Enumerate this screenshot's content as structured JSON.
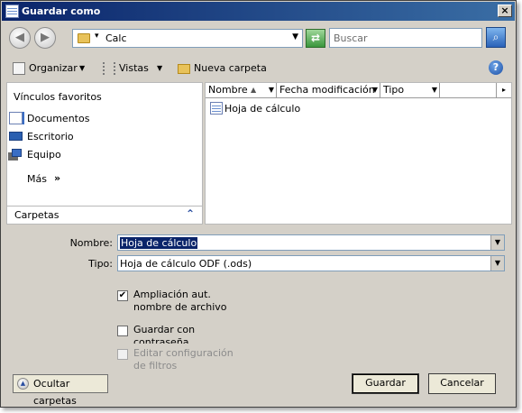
{
  "window": {
    "title": "Guardar como"
  },
  "nav": {
    "address": "Calc",
    "search_placeholder": "Buscar"
  },
  "toolbar": {
    "organize": "Organizar",
    "views": "Vistas",
    "new_folder": "Nueva carpeta"
  },
  "sidebar": {
    "favorites_header": "Vínculos favoritos",
    "items": [
      {
        "label": "Documentos"
      },
      {
        "label": "Escritorio"
      },
      {
        "label": "Equipo"
      }
    ],
    "more": "Más",
    "more_arrow": "»",
    "folders": "Carpetas"
  },
  "file_list": {
    "columns": [
      "Nombre",
      "Fecha modificación",
      "Tipo"
    ],
    "items": [
      {
        "name": "Hoja de cálculo"
      }
    ]
  },
  "form": {
    "name_label": "Nombre:",
    "name_value": "Hoja de cálculo",
    "type_label": "Tipo:",
    "type_value": "Hoja de cálculo ODF (.ods)"
  },
  "options": {
    "auto_ext": "Ampliación aut. nombre de archivo",
    "password": "Guardar con contraseña",
    "filter": "Editar configuración de filtros"
  },
  "buttons": {
    "hide_folders": "Ocultar carpetas",
    "save": "Guardar",
    "cancel": "Cancelar"
  }
}
